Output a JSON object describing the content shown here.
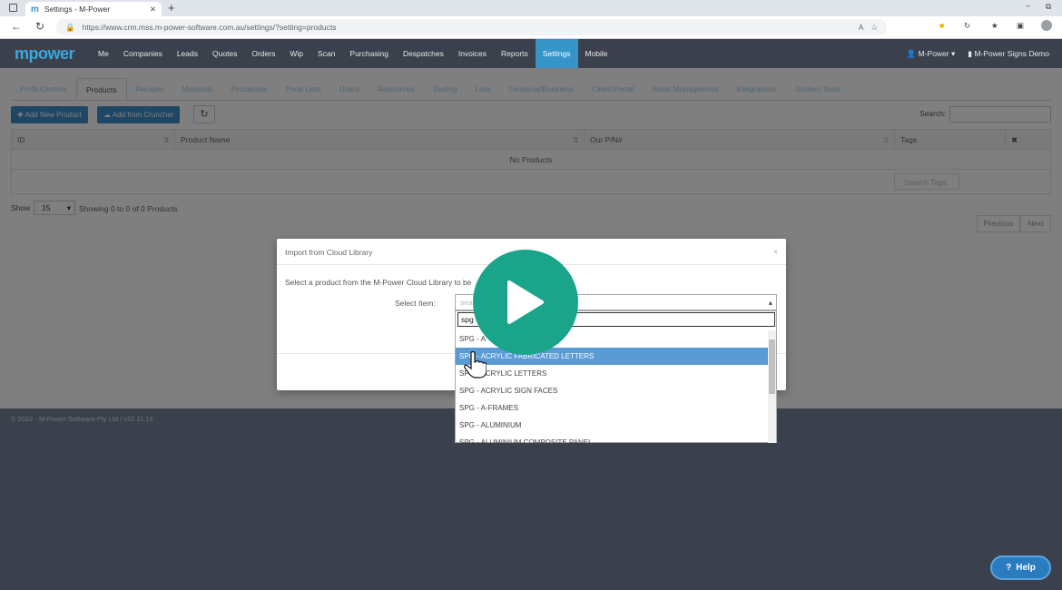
{
  "browser": {
    "tab_title": "Settings - M-Power",
    "url": "https://www.crm.mss.m-power-software.com.au/settings/?setting=products"
  },
  "app": {
    "logo": "mpower",
    "nav": [
      "Me",
      "Companies",
      "Leads",
      "Quotes",
      "Orders",
      "Wip",
      "Scan",
      "Purchasing",
      "Despatches",
      "Invoices",
      "Reports",
      "Settings",
      "Mobile"
    ],
    "active_nav": "Settings",
    "user": "M-Power",
    "company": "M-Power Signs Demo"
  },
  "subtabs": [
    "Profit Centres",
    "Products",
    "Recipes",
    "Materials",
    "Processes",
    "Price Lists",
    "Users",
    "Resources",
    "Tooling",
    "Lists",
    "Financial/Business",
    "Client Portal",
    "Asset Management",
    "Integrations",
    "System Tools"
  ],
  "active_subtab": "Products",
  "toolbar": {
    "add_new": "Add New Product",
    "add_cruncher": "Add from Cruncher",
    "search_label": "Search:"
  },
  "table": {
    "headers": [
      "ID",
      "Product Name",
      "Our P/N#",
      "Tags"
    ],
    "empty": "No Products",
    "tag_placeholder": "Search Tags"
  },
  "pager": {
    "show_label": "Show",
    "page_size": "15",
    "info": "Showing 0 to 0 of 0 Products",
    "prev": "Previous",
    "next": "Next"
  },
  "footer": {
    "copyright": "© 2022 - M-Power Software Pty Ltd | v22.11.19"
  },
  "modal": {
    "title": "Import from Cloud Library",
    "instruction": "Select a product from the M-Power Cloud Library to be",
    "select_label": "Select Item:",
    "select_placeholder": "sea",
    "search_value": "spg",
    "options": [
      "SPG - A",
      "SPG - ACRYLIC FABRICATED LETTERS",
      "SPG - ACRYLIC LETTERS",
      "SPG - ACRYLIC SIGN FACES",
      "SPG - A-FRAMES",
      "SPG - ALUMINIUM",
      "SPG - ALUMINIUM COMPOSITE PANEL"
    ],
    "highlighted_index": 1
  },
  "help": "Help",
  "colors": {
    "accent": "#3a8fc8",
    "nav_bg": "#3b414c",
    "play": "#1aa58b"
  }
}
